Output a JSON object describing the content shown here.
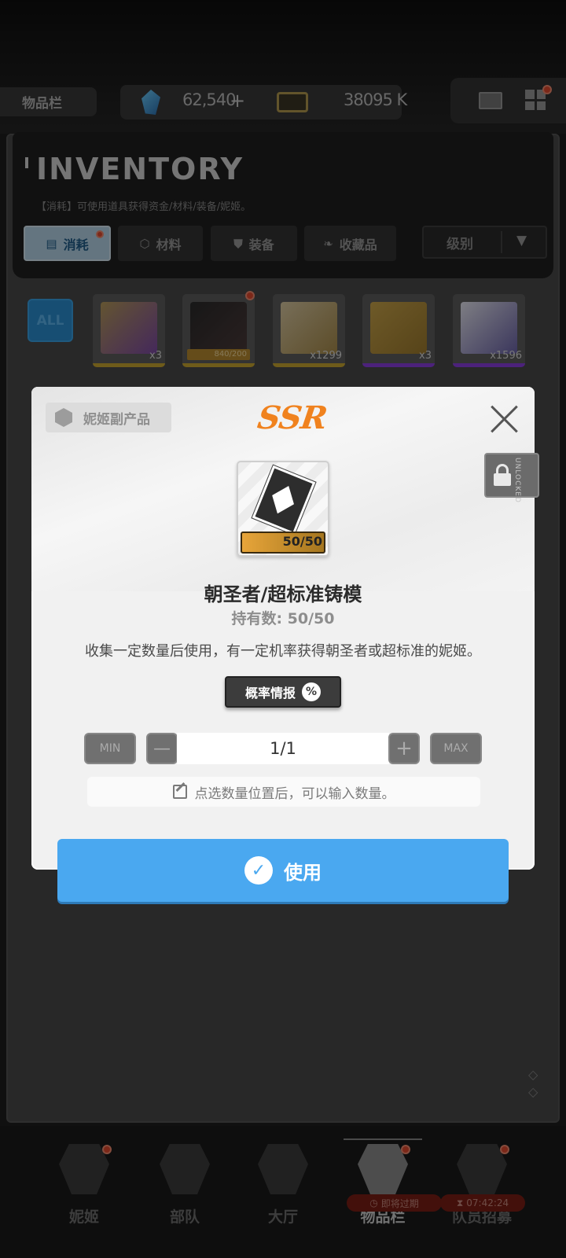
{
  "topbar": {
    "title": "物品栏",
    "gems": "62,540",
    "gems_plus": "+",
    "credits": "38095 K"
  },
  "inventory": {
    "title": "INVENTORY",
    "subtitle": "【消耗】可使用道具获得资金/材料/装备/妮姬。",
    "tabs": [
      {
        "label": "消耗",
        "icon": "consumable-icon"
      },
      {
        "label": "材料",
        "icon": "material-icon"
      },
      {
        "label": "装备",
        "icon": "equipment-icon"
      },
      {
        "label": "收藏品",
        "icon": "collection-icon"
      }
    ],
    "sort_label": "级别",
    "sort_arrow": "▼",
    "filter_all": "ALL",
    "items": [
      {
        "qty": "x3",
        "color": "#c9a630"
      },
      {
        "qty": "840/200",
        "color": "#c9a630"
      },
      {
        "qty": "x1299",
        "color": "#c9a630"
      },
      {
        "qty": "x3",
        "color": "#8a3fe0"
      },
      {
        "qty": "x1596",
        "color": "#8a3fe0"
      }
    ]
  },
  "modal": {
    "category": "妮姬副产品",
    "rarity": "SSR",
    "item_count": "50/50",
    "item_name": "朝圣者/超标准铸模",
    "owned": "持有数: 50/50",
    "description": "收集一定数量后使用，有一定机率获得朝圣者或超标准的妮姬。",
    "prob_button": "概率情报",
    "prob_icon": "%",
    "min_label": "MIN",
    "max_label": "MAX",
    "quantity": "1/1",
    "hint": "点选数量位置后，可以输入数量。",
    "use_button": "使用",
    "unlock_label": "UNLOCKED"
  },
  "nav": {
    "items": [
      {
        "label": "妮姬"
      },
      {
        "label": "部队"
      },
      {
        "label": "大厅"
      },
      {
        "label": "物品栏"
      },
      {
        "label": "队员招募"
      }
    ],
    "badge_expiring": "即将过期",
    "badge_timer": "07:42:24"
  },
  "colors": {
    "accent_blue": "#4aa8f0",
    "ssr_orange": "#f0821e",
    "alert_red": "#e24a2f"
  }
}
